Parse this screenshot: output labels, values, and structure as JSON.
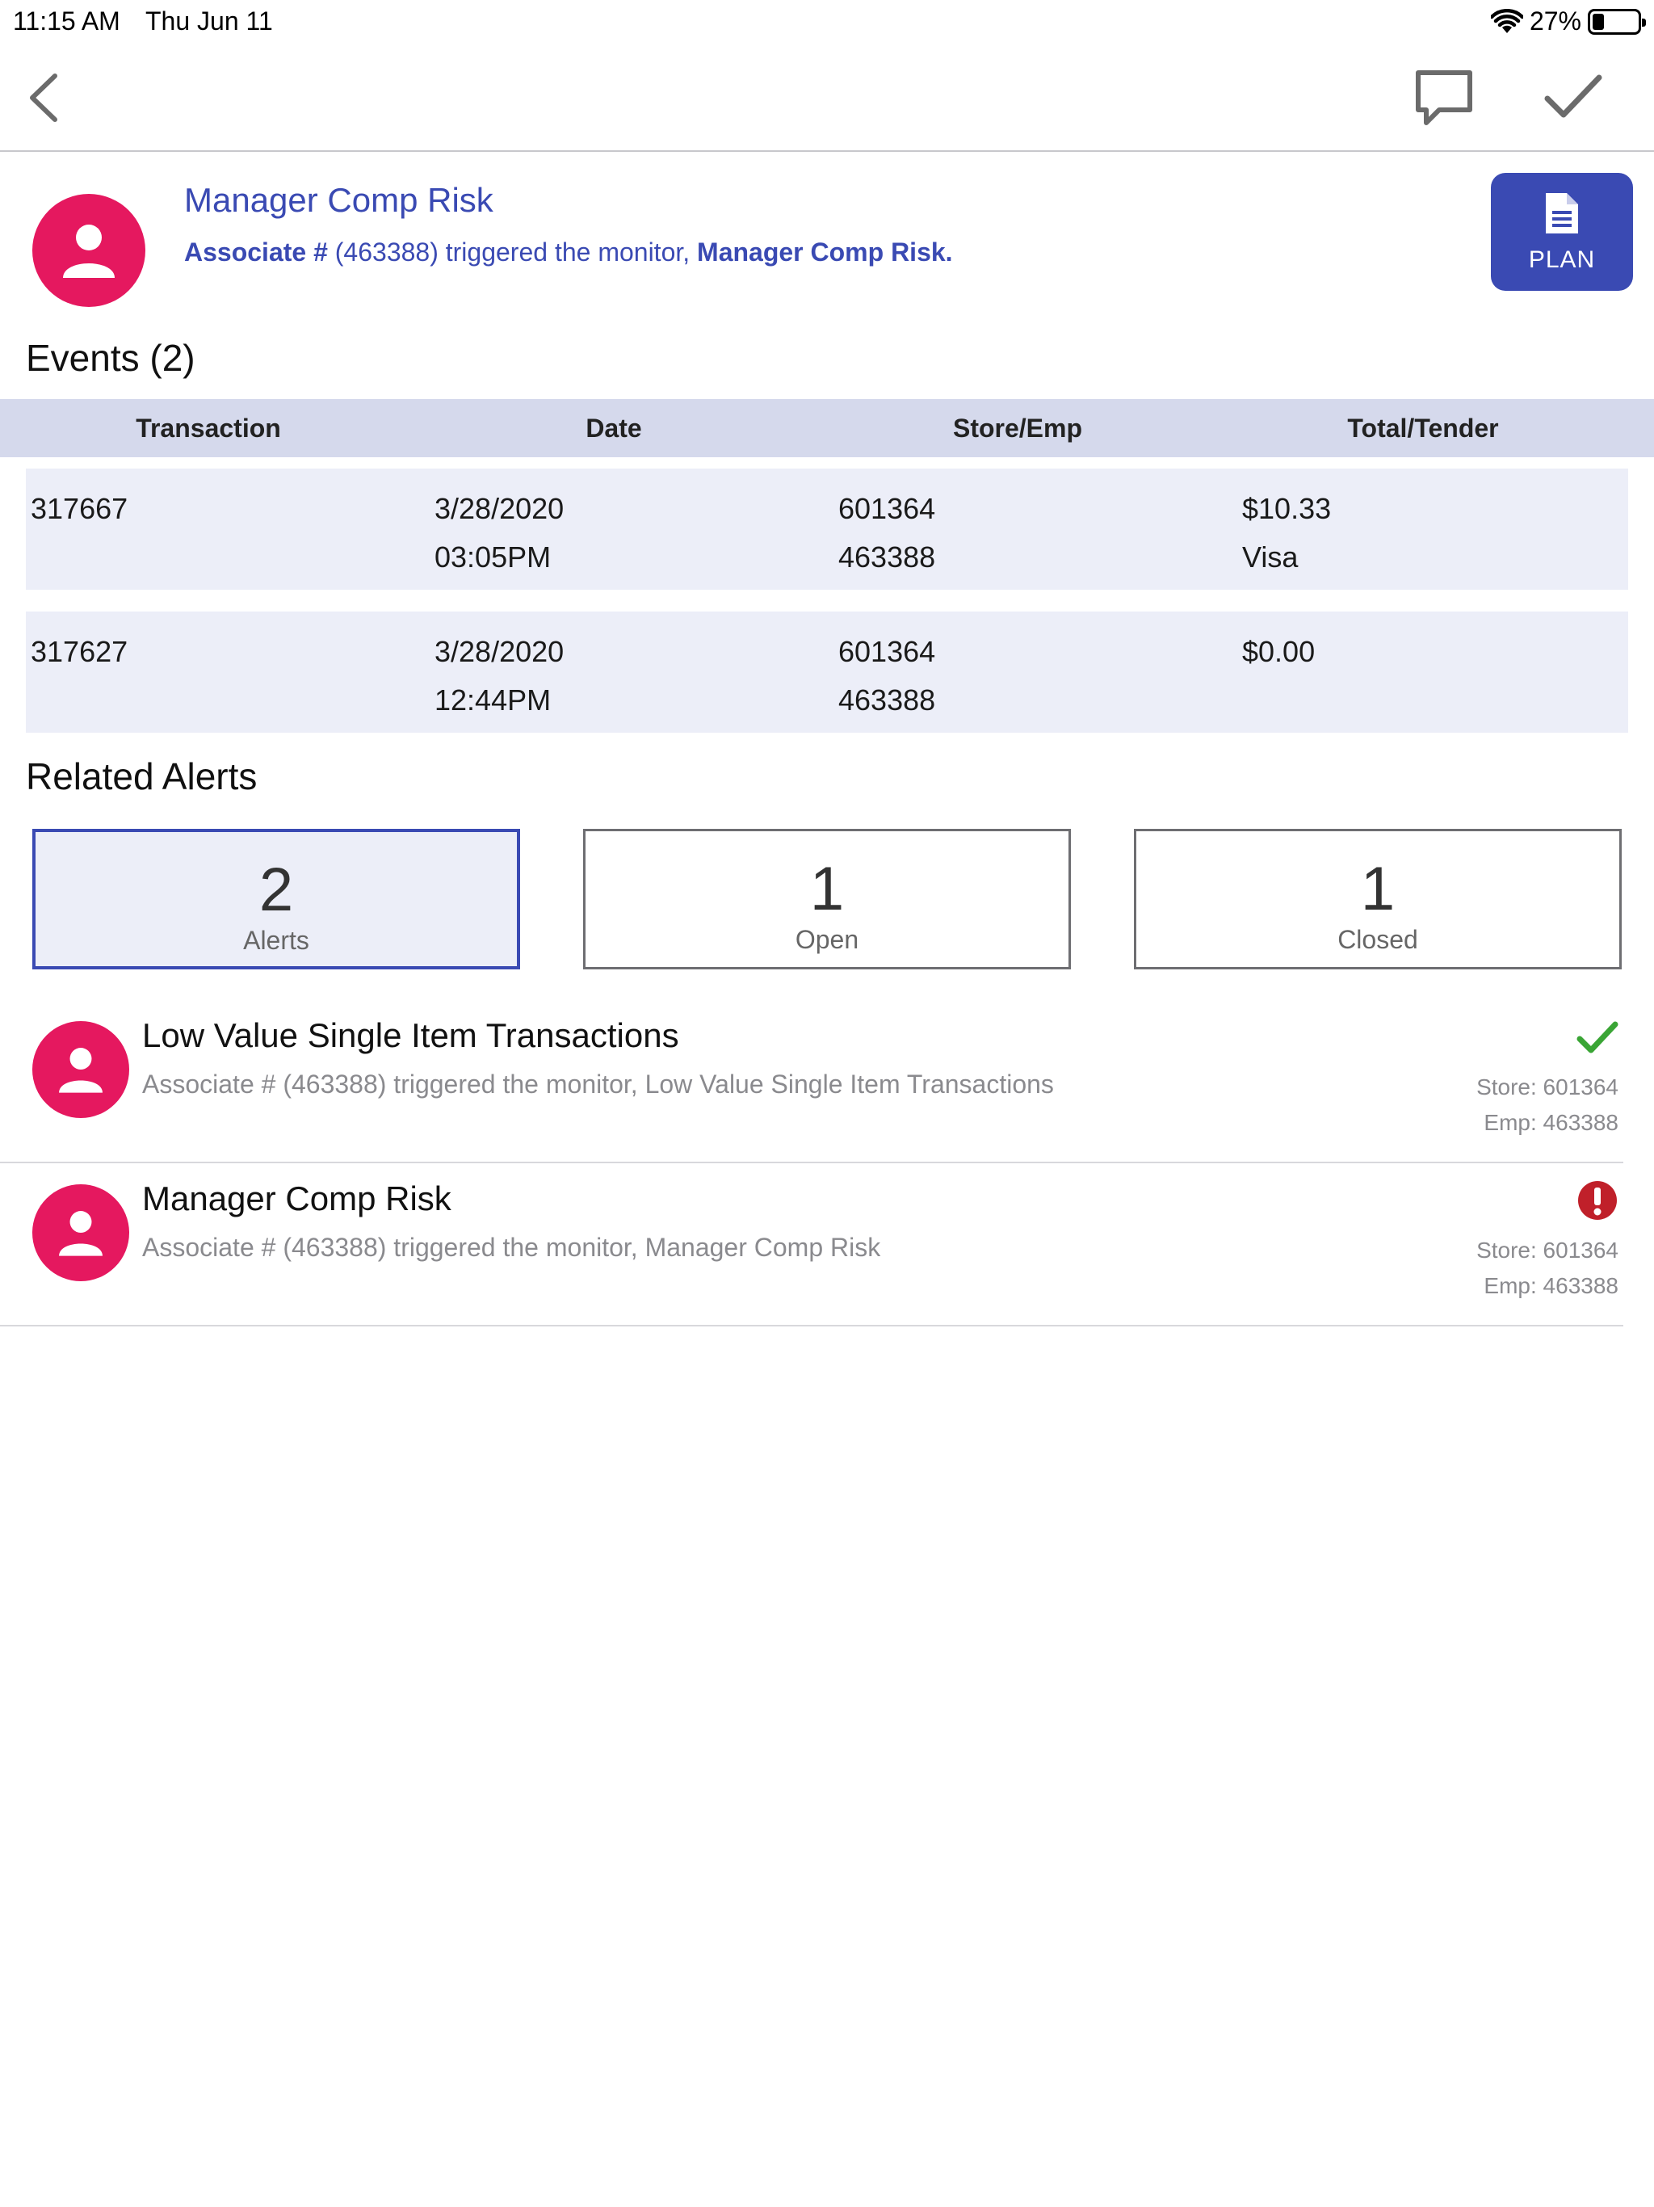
{
  "status_bar": {
    "time": "11:15 AM",
    "date": "Thu Jun 11",
    "battery": "27%"
  },
  "header": {
    "title": "Manager Comp Risk",
    "subtitle_prefix": "Associate #",
    "subtitle_mid": " (463388) triggered the monitor, ",
    "subtitle_bold": "Manager Comp Risk.",
    "plan_label": "PLAN"
  },
  "events": {
    "title": "Events (2)",
    "columns": [
      "Transaction",
      "Date",
      "Store/Emp",
      "Total/Tender"
    ],
    "rows": [
      {
        "transaction": "317667",
        "date": "3/28/2020",
        "time": "03:05PM",
        "store": "601364",
        "emp": "463388",
        "total": "$10.33",
        "tender": "Visa"
      },
      {
        "transaction": "317627",
        "date": "3/28/2020",
        "time": "12:44PM",
        "store": "601364",
        "emp": "463388",
        "total": "$0.00",
        "tender": ""
      }
    ]
  },
  "related_alerts": {
    "title": "Related Alerts",
    "summary": [
      {
        "count": "2",
        "label": "Alerts"
      },
      {
        "count": "1",
        "label": "Open"
      },
      {
        "count": "1",
        "label": "Closed"
      }
    ],
    "items": [
      {
        "title": "Low Value Single Item Transactions",
        "subtitle": "Associate # (463388) triggered the monitor, Low Value Single Item Transactions",
        "store": "Store: 601364",
        "emp": "Emp: 463388",
        "status": "closed",
        "status_icon": "check-icon",
        "status_color": "#3aa535"
      },
      {
        "title": "Manager Comp Risk",
        "subtitle": "Associate # (463388) triggered the monitor, Manager Comp Risk",
        "store": "Store: 601364",
        "emp": "Emp: 463388",
        "status": "open",
        "status_icon": "alert-icon",
        "status_color": "#c0202a"
      }
    ]
  },
  "colors": {
    "accent": "#3a4ab3",
    "avatar": "#e5185f",
    "table_header": "#d5d9ec",
    "row_bg": "#eceef8"
  }
}
